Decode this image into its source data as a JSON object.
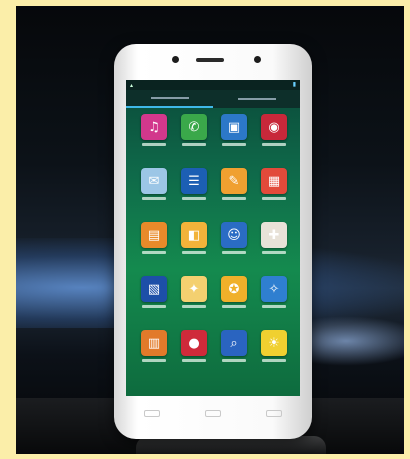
{
  "scene": {
    "background_color": "#fbeea9",
    "screen_color": "#148a4e",
    "accent_color": "#3fb8e8"
  },
  "phone": {
    "status_bar": {
      "icons": [
        "signal-icon",
        "battery-icon"
      ]
    },
    "tabs": [
      {
        "name": "tab-apps",
        "active": true
      },
      {
        "name": "tab-widgets",
        "active": false
      }
    ],
    "apps": [
      {
        "icon": "music-icon",
        "glyph": "♫",
        "color": "#d2388c"
      },
      {
        "icon": "phone-icon",
        "glyph": "✆",
        "color": "#3aa84a"
      },
      {
        "icon": "file-manager-icon",
        "glyph": "▣",
        "color": "#2c78c8"
      },
      {
        "icon": "camera-icon",
        "glyph": "◉",
        "color": "#c8283a"
      },
      {
        "icon": "message-icon",
        "glyph": "✉",
        "color": "#9cc6e6"
      },
      {
        "icon": "contacts-icon",
        "glyph": "☰",
        "color": "#1c5fb4"
      },
      {
        "icon": "chat-icon",
        "glyph": "✎",
        "color": "#f0a030"
      },
      {
        "icon": "calendar-icon",
        "glyph": "▦",
        "color": "#e24a3a"
      },
      {
        "icon": "gallery-icon",
        "glyph": "▤",
        "color": "#e88a2a"
      },
      {
        "icon": "photos-icon",
        "glyph": "◧",
        "color": "#f2b33a"
      },
      {
        "icon": "assistant-icon",
        "glyph": "☺",
        "color": "#2a6cc4"
      },
      {
        "icon": "notes-icon",
        "glyph": "✚",
        "color": "#e8e2d8"
      },
      {
        "icon": "browser-icon",
        "glyph": "▧",
        "color": "#1d4fa8"
      },
      {
        "icon": "settings-icon",
        "glyph": "✦",
        "color": "#f4d070"
      },
      {
        "icon": "tools-icon",
        "glyph": "✪",
        "color": "#f0b02a"
      },
      {
        "icon": "maps-icon",
        "glyph": "✧",
        "color": "#2f7fd0"
      },
      {
        "icon": "store-icon",
        "glyph": "▥",
        "color": "#e27a2a"
      },
      {
        "icon": "alarm-icon",
        "glyph": "●",
        "color": "#cf2a3a"
      },
      {
        "icon": "search-icon",
        "glyph": "⌕",
        "color": "#2a64c0"
      },
      {
        "icon": "weather-icon",
        "glyph": "☀",
        "color": "#f0d030"
      }
    ],
    "nav_keys": [
      "menu-key-icon",
      "home-key-icon",
      "back-key-icon"
    ]
  }
}
